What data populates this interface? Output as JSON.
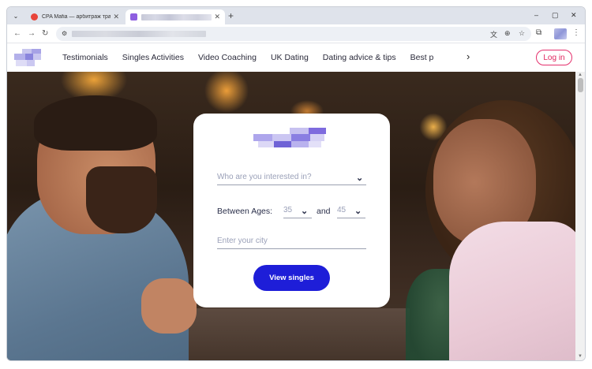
{
  "browser": {
    "tabs": [
      {
        "title": "CPA Mafia — арбитраж трафи…",
        "favicon_color": "#e8443a"
      },
      {
        "title": "",
        "favicon_color": "#8e5ee0"
      }
    ],
    "new_tab_symbol": "+",
    "window_controls": [
      "–",
      "▢",
      "✕"
    ],
    "nav_buttons": [
      "←",
      "→",
      "↻"
    ],
    "address_bar": {
      "site_icon": "⚙",
      "url": ""
    },
    "omnibox_icons": [
      "translate-icon",
      "zoom-icon",
      "bookmark-star-icon"
    ],
    "toolbar_icons": [
      "extensions-icon",
      "profile-avatar",
      "menu-icon"
    ]
  },
  "site": {
    "nav_links": [
      "Testimonials",
      "Singles Activities",
      "Video Coaching",
      "UK Dating",
      "Dating advice & tips",
      "Best p"
    ],
    "nav_next_symbol": "›",
    "login_label": "Log in",
    "accent_color": "#e0245e"
  },
  "form": {
    "interest_placeholder": "Who are you interested in?",
    "ages_label": "Between Ages:",
    "age_min": "35",
    "and_label": "and",
    "age_max": "45",
    "city_placeholder": "Enter your city",
    "cta_label": "View singles",
    "cta_color": "#1e1ed8"
  }
}
